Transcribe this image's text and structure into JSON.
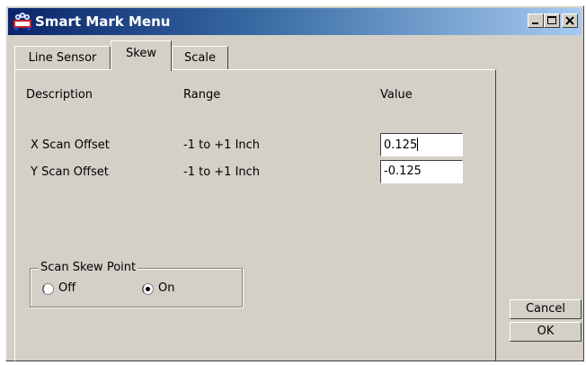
{
  "window": {
    "title": "Smart Mark Menu"
  },
  "title_buttons": {
    "minimize": "minimize-icon",
    "maximize": "maximize-icon",
    "close": "close-icon"
  },
  "tabs": [
    {
      "label": "Line Sensor",
      "selected": false
    },
    {
      "label": "Skew",
      "selected": true
    },
    {
      "label": "Scale",
      "selected": false
    }
  ],
  "table": {
    "headers": {
      "description": "Description",
      "range": "Range",
      "value": "Value"
    },
    "rows": [
      {
        "description": "X Scan Offset",
        "range": "-1 to +1 Inch",
        "value": "0.125"
      },
      {
        "description": "Y Scan Offset",
        "range": "-1 to +1 Inch",
        "value": "-0.125"
      }
    ]
  },
  "scan_skew_point": {
    "label": "Scan Skew Point",
    "options": [
      {
        "label": "Off",
        "selected": false
      },
      {
        "label": "On",
        "selected": true
      }
    ]
  },
  "buttons": {
    "cancel": "Cancel",
    "ok": "OK"
  },
  "colors": {
    "title_gradient_start": "#0a246a",
    "title_gradient_end": "#a6caf0",
    "face": "#d4d0c8"
  }
}
